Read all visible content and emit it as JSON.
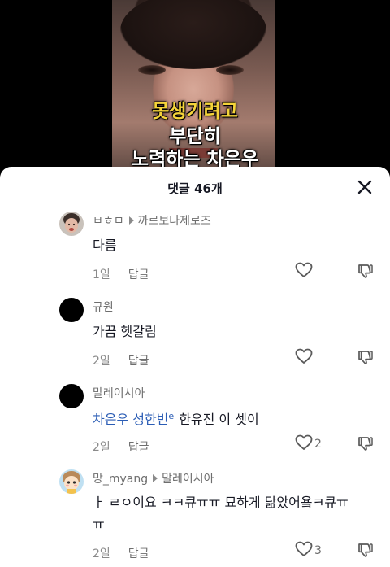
{
  "video": {
    "caption_line1": "못생기려고",
    "caption_line2": "부단히",
    "caption_line3": "노력하는 차은우"
  },
  "sheet": {
    "title": "댓글 46개",
    "close_icon": "close-icon"
  },
  "comments": [
    {
      "username": "ㅂㅎㅁ",
      "reply_to": "까르보나제로즈",
      "text": "다름",
      "time": "1일",
      "reply_label": "답글",
      "likes": "",
      "avatar": "photo-avatar"
    },
    {
      "username": "규원",
      "text": "가끔 헷갈림",
      "time": "2일",
      "reply_label": "답글",
      "likes": "",
      "avatar": "black-avatar"
    },
    {
      "username": "말레이시아",
      "mention": "차은우 성한빈",
      "text": "한유진 이 셋이",
      "time": "2일",
      "reply_label": "답글",
      "likes": "2",
      "avatar": "black-avatar"
    },
    {
      "username": "망_myang",
      "reply_to": "말레이시아",
      "text_line1": "ㅏ ㄹㅇ이요 ㅋㅋ큐ㅠㅠ 묘하게 닮았어욬ㅋ큐ㅠ",
      "text_line2": "ㅠ",
      "time": "2일",
      "reply_label": "답글",
      "likes": "3",
      "avatar": "cartoon-avatar"
    }
  ],
  "colors": {
    "caption_yellow": "#f5d43a",
    "mention_blue": "#2b5db5",
    "text": "#161823",
    "muted": "#8a8a8a"
  }
}
